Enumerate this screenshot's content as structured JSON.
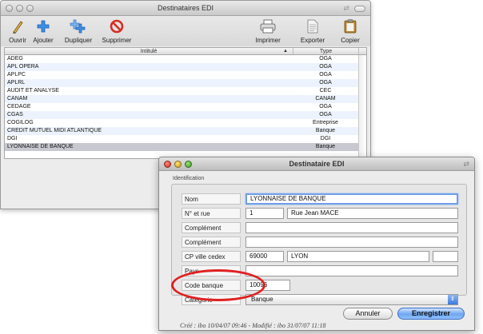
{
  "main_window": {
    "title": "Destinataires EDI",
    "toolbar": {
      "open_label": "Ouvrir",
      "add_label": "Ajouter",
      "duplicate_label": "Dupliquer",
      "delete_label": "Supprimer",
      "print_label": "Imprimer",
      "export_label": "Exporter",
      "copy_label": "Copier"
    },
    "table": {
      "columns": [
        "Intitulé",
        "Type"
      ],
      "rows": [
        {
          "name": "ADEG",
          "type": "OGA"
        },
        {
          "name": "APL OPERA",
          "type": "OGA"
        },
        {
          "name": "APLPC",
          "type": "OGA"
        },
        {
          "name": "APLRL",
          "type": "OGA"
        },
        {
          "name": "AUDIT ET ANALYSE",
          "type": "CEC"
        },
        {
          "name": "CANAM",
          "type": "CANAM"
        },
        {
          "name": "CEDAGE",
          "type": "OGA"
        },
        {
          "name": "CGAS",
          "type": "OGA"
        },
        {
          "name": "COGILOG",
          "type": "Entreprise"
        },
        {
          "name": "CREDIT MUTUEL MIDI ATLANTIQUE",
          "type": "Banque"
        },
        {
          "name": "DGI",
          "type": "DGI"
        },
        {
          "name": "LYONNAISE DE BANQUE",
          "type": "Banque"
        }
      ],
      "selected_row": "LYONNAISE DE BANQUE"
    }
  },
  "dialog": {
    "title": "Destinataire EDI",
    "group_label": "Identification",
    "labels": {
      "nom": "Nom",
      "rue": "N° et rue",
      "complement1": "Complément",
      "complement2": "Complément",
      "cp_ville": "CP ville cedex",
      "pays": "Pays",
      "code_banque": "Code banque",
      "categorie": "Catégorie"
    },
    "values": {
      "nom": "LYONNAISE DE BANQUE",
      "numero": "1",
      "rue": "Rue Jean MACE",
      "complement1": "",
      "complement2": "",
      "cp": "69000",
      "ville": "LYON",
      "cedex": "",
      "pays": "",
      "code_banque": "10096",
      "categorie": "Banque"
    },
    "buttons": {
      "cancel": "Annuler",
      "save": "Enregistrer"
    },
    "footer": "Créé : ibo 10/04/07 09:46 - Modifié : ibo 31/07/07 11:18"
  },
  "colors": {
    "highlight": "#e02020",
    "selection": "#c8c8d0",
    "focus_ring": "#6f9ee8"
  }
}
